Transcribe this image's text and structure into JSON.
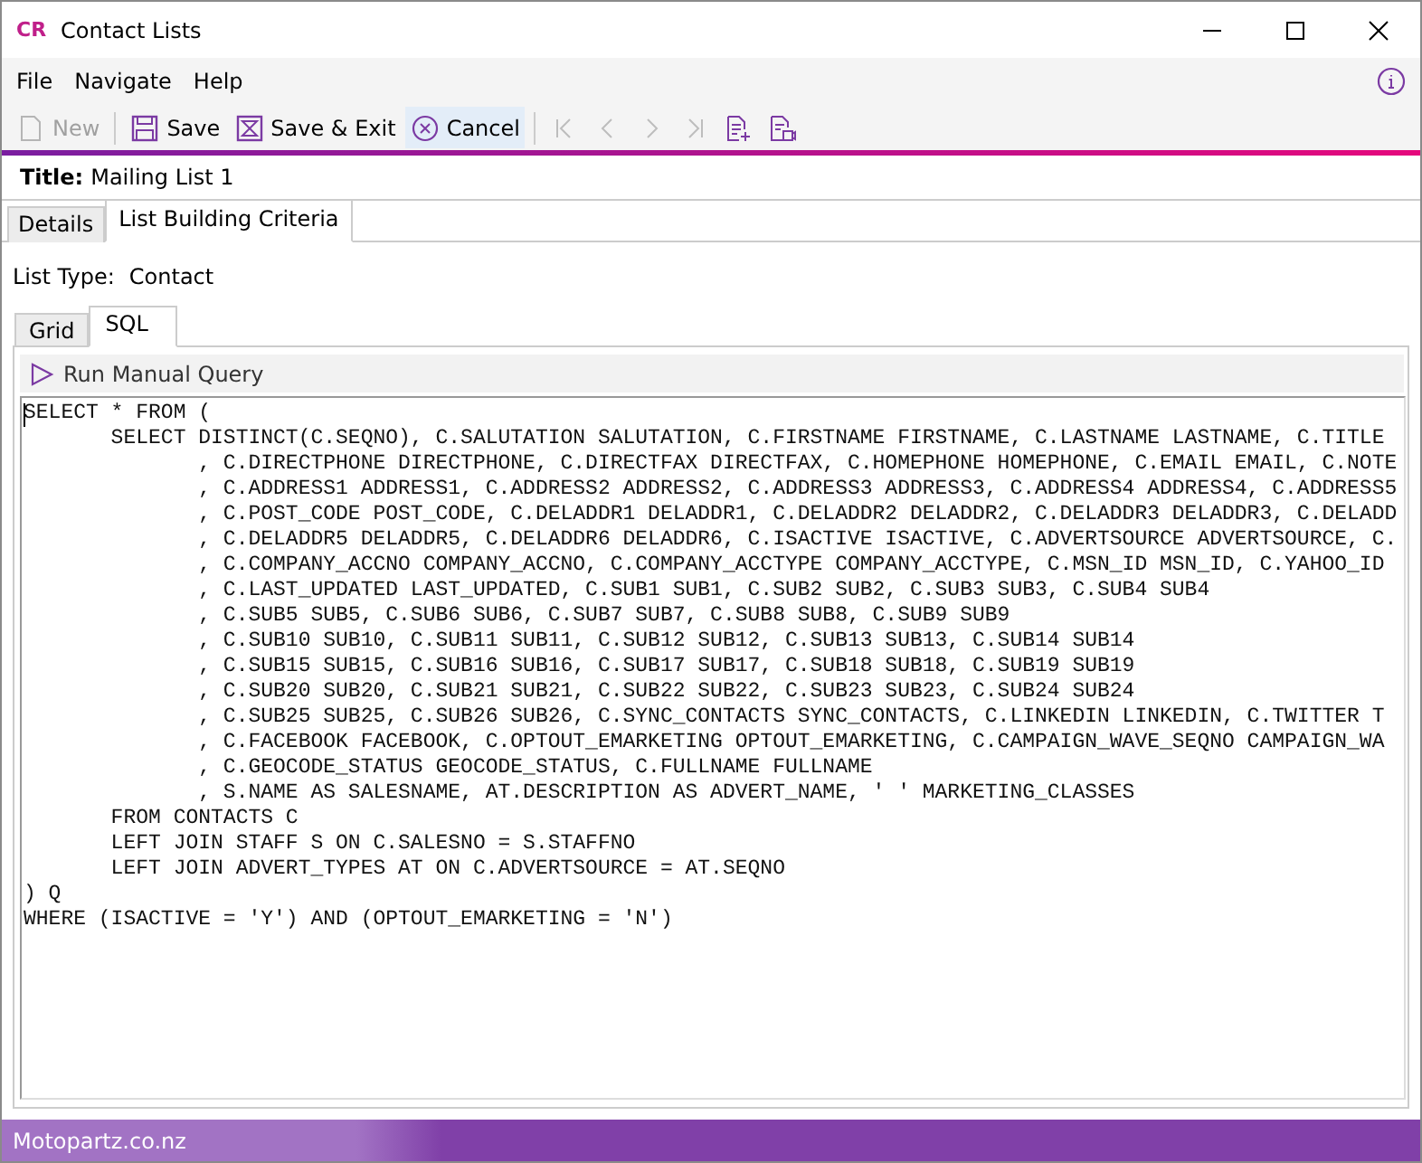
{
  "window": {
    "logo": "CR",
    "title": "Contact Lists"
  },
  "menu": [
    {
      "label": "File"
    },
    {
      "label": "Navigate"
    },
    {
      "label": "Help"
    }
  ],
  "toolbar": [
    {
      "kind": "new",
      "label": "New",
      "disabled": true,
      "hovered": false
    },
    {
      "kind": "save",
      "label": "Save",
      "disabled": false,
      "hovered": false
    },
    {
      "kind": "save-exit",
      "label": "Save & Exit",
      "disabled": false,
      "hovered": false
    },
    {
      "kind": "cancel",
      "label": "Cancel",
      "disabled": false,
      "hovered": true
    }
  ],
  "toolbar_icons": [
    {
      "kind": "first",
      "disabled": true
    },
    {
      "kind": "prev",
      "disabled": true
    },
    {
      "kind": "next",
      "disabled": true
    },
    {
      "kind": "last",
      "disabled": true
    },
    {
      "kind": "doc-add",
      "disabled": false
    },
    {
      "kind": "doc-view",
      "disabled": false
    }
  ],
  "title_field": {
    "label": "Title:",
    "value": "Mailing List 1"
  },
  "tabs": [
    {
      "label": "Details",
      "selected": false
    },
    {
      "label": "List Building Criteria",
      "selected": true
    }
  ],
  "list_type": {
    "label": "List Type:",
    "value": "Contact"
  },
  "sub_tabs": [
    {
      "label": "Grid",
      "selected": false
    },
    {
      "label": "SQL",
      "selected": true
    }
  ],
  "run_button": {
    "label": "Run Manual Query"
  },
  "sql_lines": [
    "SELECT * FROM (",
    "       SELECT DISTINCT(C.SEQNO), C.SALUTATION SALUTATION, C.FIRSTNAME FIRSTNAME, C.LASTNAME LASTNAME, C.TITLE",
    "              , C.DIRECTPHONE DIRECTPHONE, C.DIRECTFAX DIRECTFAX, C.HOMEPHONE HOMEPHONE, C.EMAIL EMAIL, C.NOTE",
    "              , C.ADDRESS1 ADDRESS1, C.ADDRESS2 ADDRESS2, C.ADDRESS3 ADDRESS3, C.ADDRESS4 ADDRESS4, C.ADDRESS5",
    "              , C.POST_CODE POST_CODE, C.DELADDR1 DELADDR1, C.DELADDR2 DELADDR2, C.DELADDR3 DELADDR3, C.DELADD",
    "              , C.DELADDR5 DELADDR5, C.DELADDR6 DELADDR6, C.ISACTIVE ISACTIVE, C.ADVERTSOURCE ADVERTSOURCE, C.",
    "              , C.COMPANY_ACCNO COMPANY_ACCNO, C.COMPANY_ACCTYPE COMPANY_ACCTYPE, C.MSN_ID MSN_ID, C.YAHOO_ID",
    "              , C.LAST_UPDATED LAST_UPDATED, C.SUB1 SUB1, C.SUB2 SUB2, C.SUB3 SUB3, C.SUB4 SUB4",
    "              , C.SUB5 SUB5, C.SUB6 SUB6, C.SUB7 SUB7, C.SUB8 SUB8, C.SUB9 SUB9",
    "              , C.SUB10 SUB10, C.SUB11 SUB11, C.SUB12 SUB12, C.SUB13 SUB13, C.SUB14 SUB14",
    "              , C.SUB15 SUB15, C.SUB16 SUB16, C.SUB17 SUB17, C.SUB18 SUB18, C.SUB19 SUB19",
    "              , C.SUB20 SUB20, C.SUB21 SUB21, C.SUB22 SUB22, C.SUB23 SUB23, C.SUB24 SUB24",
    "              , C.SUB25 SUB25, C.SUB26 SUB26, C.SYNC_CONTACTS SYNC_CONTACTS, C.LINKEDIN LINKEDIN, C.TWITTER T",
    "              , C.FACEBOOK FACEBOOK, C.OPTOUT_EMARKETING OPTOUT_EMARKETING, C.CAMPAIGN_WAVE_SEQNO CAMPAIGN_WA",
    "              , C.GEOCODE_STATUS GEOCODE_STATUS, C.FULLNAME FULLNAME",
    "              , S.NAME AS SALESNAME, AT.DESCRIPTION AS ADVERT_NAME, ' ' MARKETING_CLASSES",
    "       FROM CONTACTS C",
    "       LEFT JOIN STAFF S ON C.SALESNO = S.STAFFNO",
    "       LEFT JOIN ADVERT_TYPES AT ON C.ADVERTSOURCE = AT.SEQNO",
    ") Q",
    "WHERE (ISACTIVE = 'Y') AND (OPTOUT_EMARKETING = 'N')"
  ],
  "status_bar": {
    "text": "Motopartz.co.nz"
  }
}
